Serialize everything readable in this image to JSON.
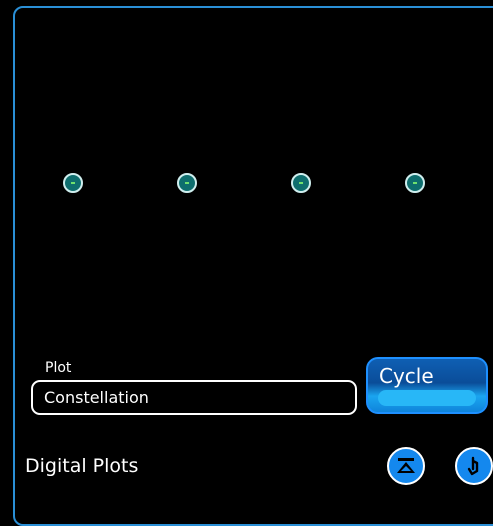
{
  "plot": {
    "type": "constellation",
    "symbols": [
      {
        "i": -3,
        "q": 0
      },
      {
        "i": -1,
        "q": 0
      },
      {
        "i": 1,
        "q": 0
      },
      {
        "i": 3,
        "q": 0
      }
    ]
  },
  "controls": {
    "plot_label": "Plot",
    "plot_value": "Constellation",
    "cycle_label": "Cycle"
  },
  "footer": {
    "title": "Digital Plots",
    "collapse_icon": "collapse-top-icon",
    "help_icon": "hand-pointer-icon"
  },
  "colors": {
    "frame": "#2a8fd6",
    "point_fill": "#0e6e6e",
    "accent": "#1488ee"
  }
}
